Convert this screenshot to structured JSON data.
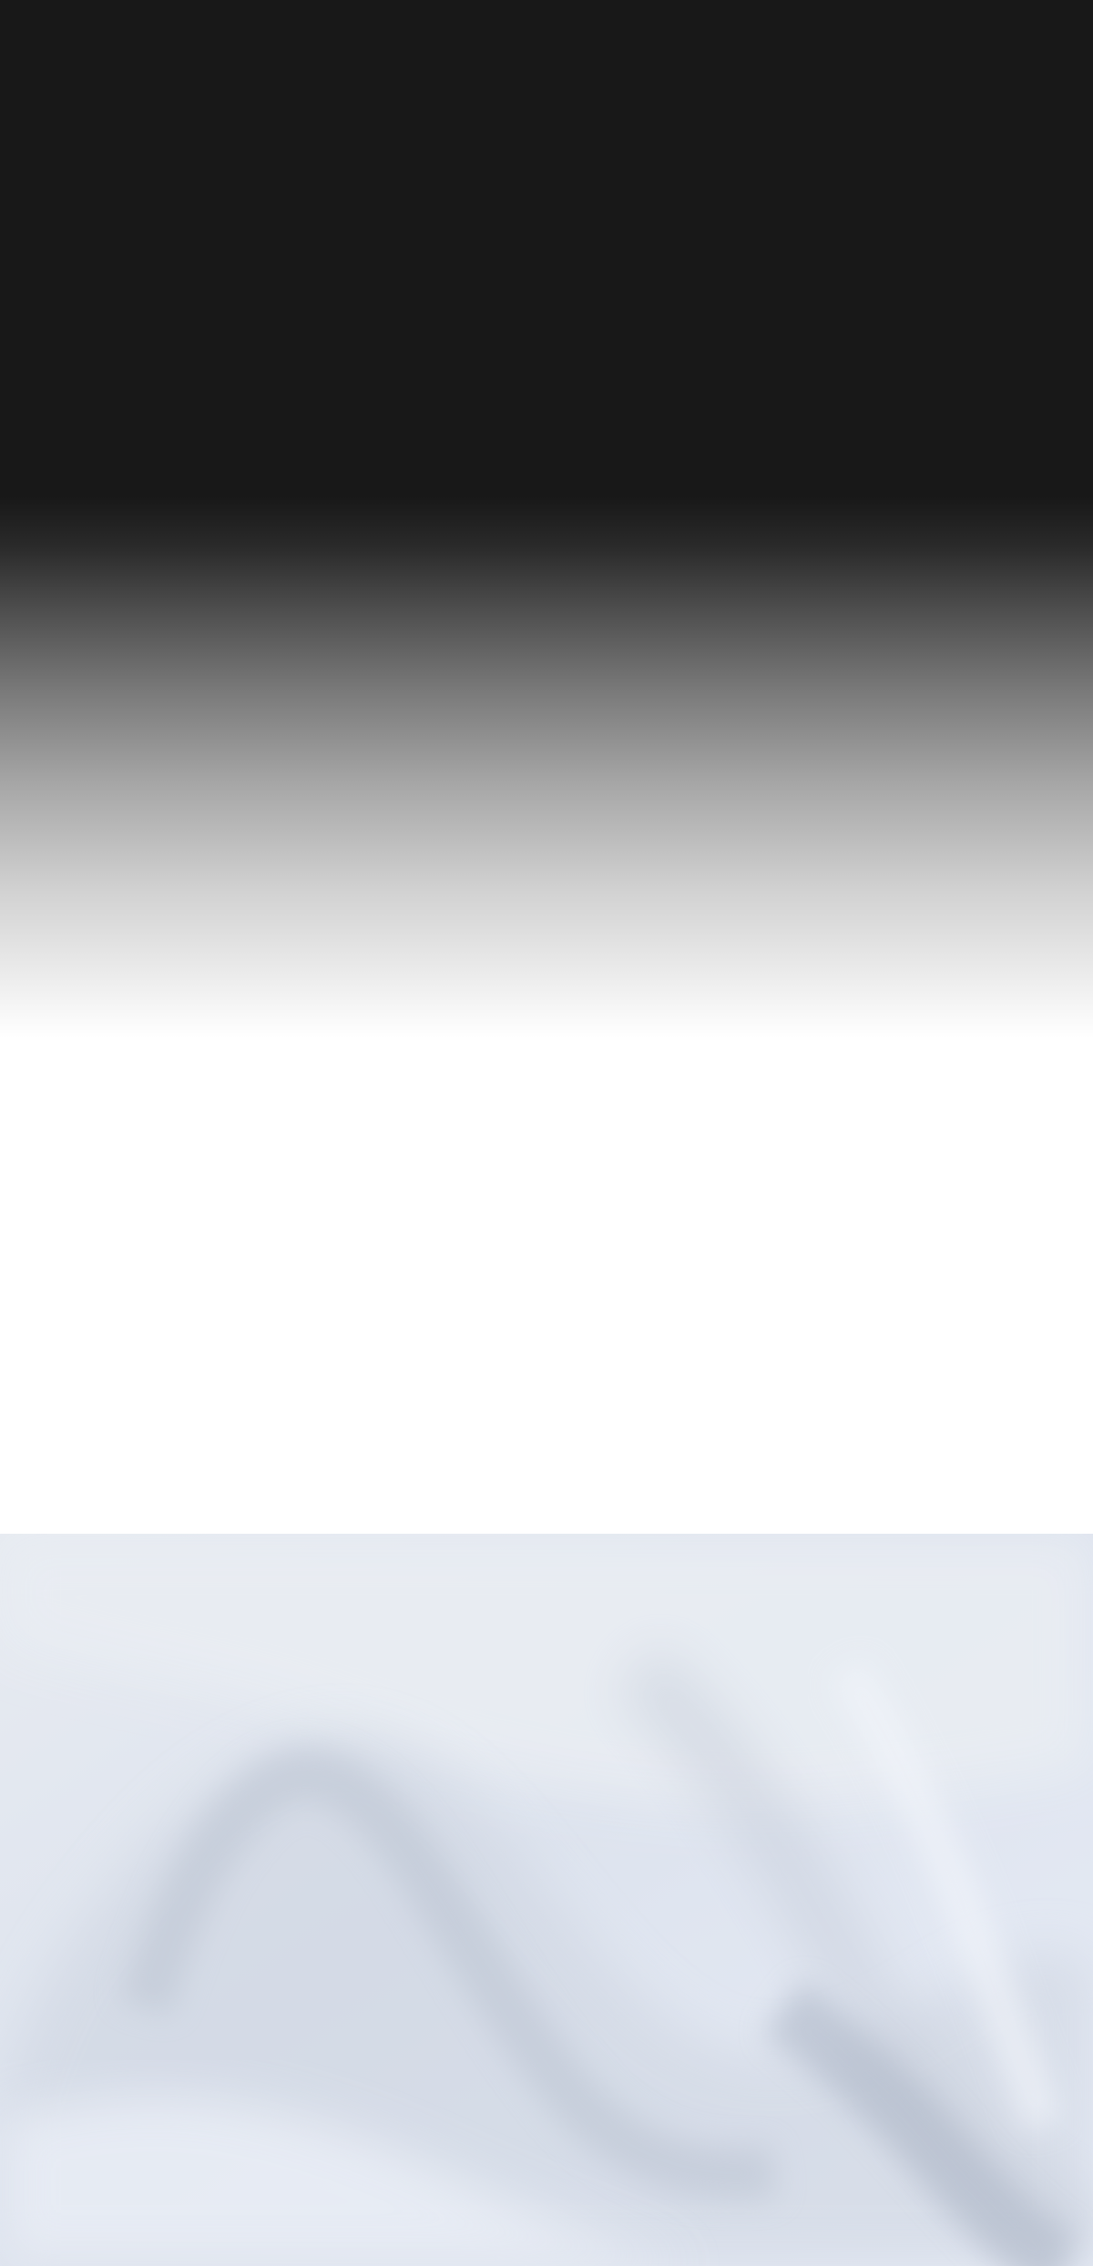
{
  "page": {
    "background_colors": {
      "top_dark": "#181818",
      "middle_white": "#ffffff",
      "bottom_silk": "#e6ebf2",
      "silk_shadow": "#b4bccb"
    }
  }
}
